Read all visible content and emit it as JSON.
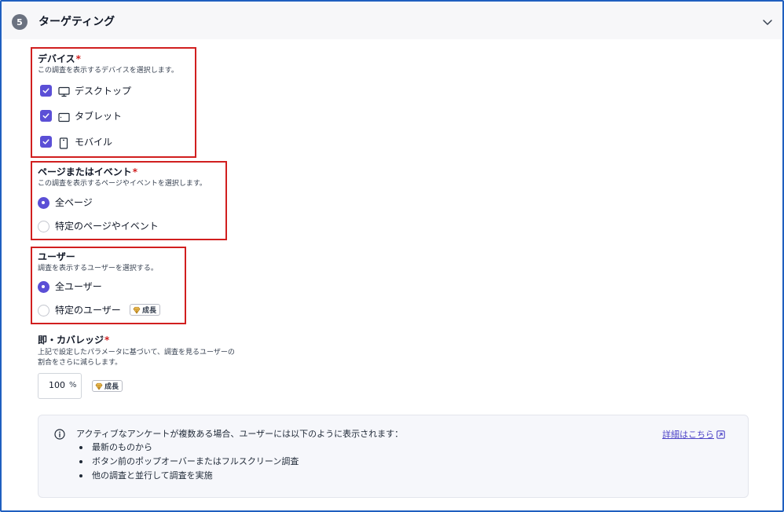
{
  "section": {
    "step_number": "5",
    "title": "ターゲティング"
  },
  "devices": {
    "title": "デバイス",
    "required_mark": "*",
    "description": "この調査を表示するデバイスを選択します。",
    "options": [
      {
        "label": "デスクトップ",
        "checked": true,
        "icon": "monitor-icon"
      },
      {
        "label": "タブレット",
        "checked": true,
        "icon": "tablet-icon"
      },
      {
        "label": "モバイル",
        "checked": true,
        "icon": "mobile-icon"
      }
    ]
  },
  "pages": {
    "title": "ページまたはイベント",
    "required_mark": "*",
    "description": "この調査を表示するページやイベントを選択します。",
    "options": [
      {
        "label": "全ページ",
        "selected": true
      },
      {
        "label": "特定のページやイベント",
        "selected": false
      }
    ]
  },
  "users": {
    "title": "ユーザー",
    "description": "調査を表示するユーザーを選択する。",
    "options": [
      {
        "label": "全ユーザー",
        "selected": true
      },
      {
        "label": "特定のユーザー",
        "selected": false
      }
    ],
    "badge": "成長"
  },
  "coverage": {
    "title": "即・カバレッジ",
    "required_mark": "*",
    "description_line1": "上記で設定したパラメータに基づいて、調査を見るユーザーの",
    "description_line2": "割合をさらに減らします。",
    "value": "100",
    "unit": "%",
    "badge": "成長"
  },
  "info": {
    "text": "アクティブなアンケートが複数ある場合、ユーザーには以下のように表示されます：",
    "items": [
      "最新のものから",
      "ボタン前のポップオーバーまたはフルスクリーン調査",
      "他の調査と並行して調査を実施"
    ],
    "link_label": "詳細はこちら"
  },
  "colors": {
    "accent": "#5b4fd6",
    "required": "#d11f1f",
    "highlight_box": "#d11f1f",
    "frame": "#1f5fbf"
  }
}
